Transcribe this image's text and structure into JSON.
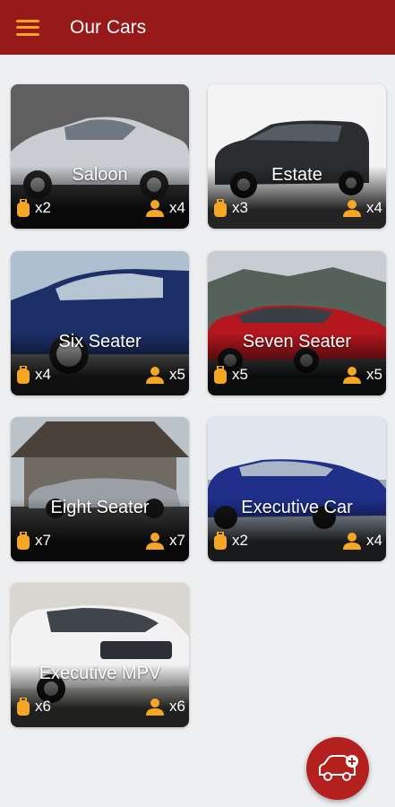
{
  "header": {
    "title": "Our Cars",
    "menu_icon": "hamburger-menu-icon"
  },
  "colors": {
    "header": "#98191a",
    "accent": "#f5a623",
    "fab": "#b3201d",
    "background": "#eeeff1"
  },
  "cars": [
    {
      "name": "Saloon",
      "bags": "x2",
      "passengers": "x4",
      "car_color": "#c9ccd0",
      "sky": "#6d6d6d"
    },
    {
      "name": "Estate",
      "bags": "x3",
      "passengers": "x4",
      "car_color": "#2b2d30",
      "sky": "#f4f4f4"
    },
    {
      "name": "Six Seater",
      "bags": "x4",
      "passengers": "x5",
      "car_color": "#1c2f66",
      "sky": "#aebfd0"
    },
    {
      "name": "Seven Seater",
      "bags": "x5",
      "passengers": "x5",
      "car_color": "#b5171e",
      "sky": "#8a9a9c"
    },
    {
      "name": "Eight Seater",
      "bags": "x7",
      "passengers": "x7",
      "car_color": "#9aa0a6",
      "sky": "#b9c3c8"
    },
    {
      "name": "Executive Car",
      "bags": "x2",
      "passengers": "x4",
      "car_color": "#1f2f8a",
      "sky": "#dfe6ee"
    },
    {
      "name": "Executive MPV",
      "bags": "x6",
      "passengers": "x6",
      "car_color": "#f2f2f2",
      "sky": "#d8d6cf"
    }
  ],
  "fab": {
    "icon": "add-taxi-icon"
  }
}
